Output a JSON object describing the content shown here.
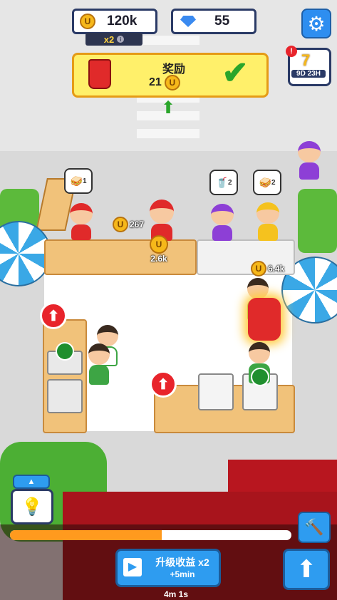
{
  "hud": {
    "coins": "120k",
    "gems": "55",
    "multiplier": "x2",
    "multiplier_info_icon": "info-icon",
    "settings_icon": "gear-icon"
  },
  "reward": {
    "title": "奖励",
    "amount": "21",
    "confirm_icon": "check-icon"
  },
  "event": {
    "label": "7",
    "timer": "9D 23H",
    "alert": "!"
  },
  "orders": [
    {
      "item": "sandwich-icon",
      "count": "1"
    },
    {
      "item": "drink-icon",
      "count": "2"
    },
    {
      "item": "sandwich-icon",
      "count": "2"
    }
  ],
  "floating": {
    "tip_1": "267",
    "tip_2": "2.6k",
    "tip_3": "6.4k"
  },
  "bottom": {
    "progress": 0.54,
    "upgrade_title": "升级收益 x2",
    "upgrade_sub": "+5min",
    "timer": "4m 1s",
    "build_icon": "hammer-icon",
    "upgrade_icon": "arrow-up-icon",
    "hint_icon": "lightbulb-icon"
  },
  "colors": {
    "accent_blue": "#2e9cf0",
    "coin": "#f6b81a",
    "progress": "#ff9a1e",
    "roof": "#a8141c"
  }
}
